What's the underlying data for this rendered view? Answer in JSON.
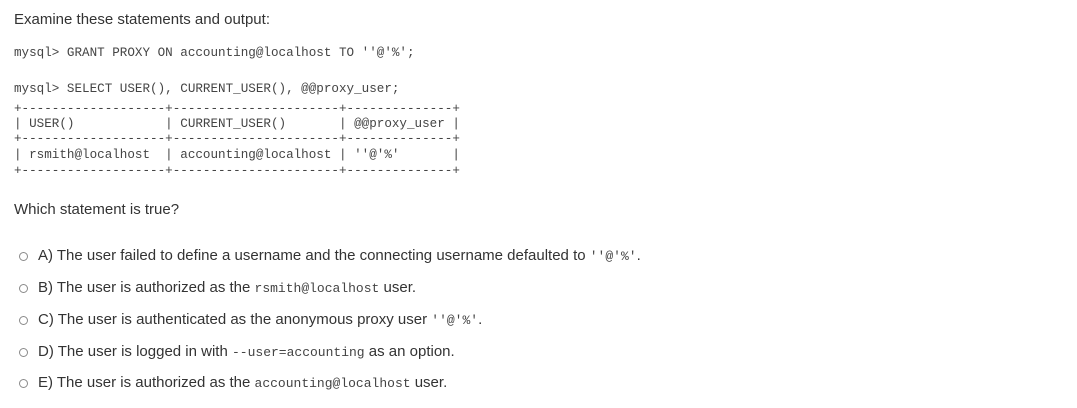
{
  "intro_text": "Examine these statements and output:",
  "code": {
    "grant_line": "mysql> GRANT PROXY ON accounting@localhost TO ''@'%';",
    "select_line": "mysql> SELECT USER(), CURRENT_USER(), @@proxy_user;",
    "table_border": "+-------------------+----------------------+--------------+",
    "table_header": "| USER()            | CURRENT_USER()       | @@proxy_user |",
    "table_row": "| rsmith@localhost  | accounting@localhost | ''@'%'       |"
  },
  "question_text": "Which statement is true?",
  "options": [
    {
      "label": "A) The user failed to define a username and the connecting username defaulted to ",
      "code": "''@'%'",
      "suffix": "."
    },
    {
      "label": "B) The user is authorized as the ",
      "code": "rsmith@localhost",
      "suffix": " user."
    },
    {
      "label": "C) The user is authenticated as the anonymous proxy user ",
      "code": "''@'%'",
      "suffix": "."
    },
    {
      "label": "D) The user is logged in with ",
      "code": "--user=accounting",
      "suffix": " as an option."
    },
    {
      "label": "E) The user is authorized as the ",
      "code": "accounting@localhost",
      "suffix": " user."
    }
  ]
}
